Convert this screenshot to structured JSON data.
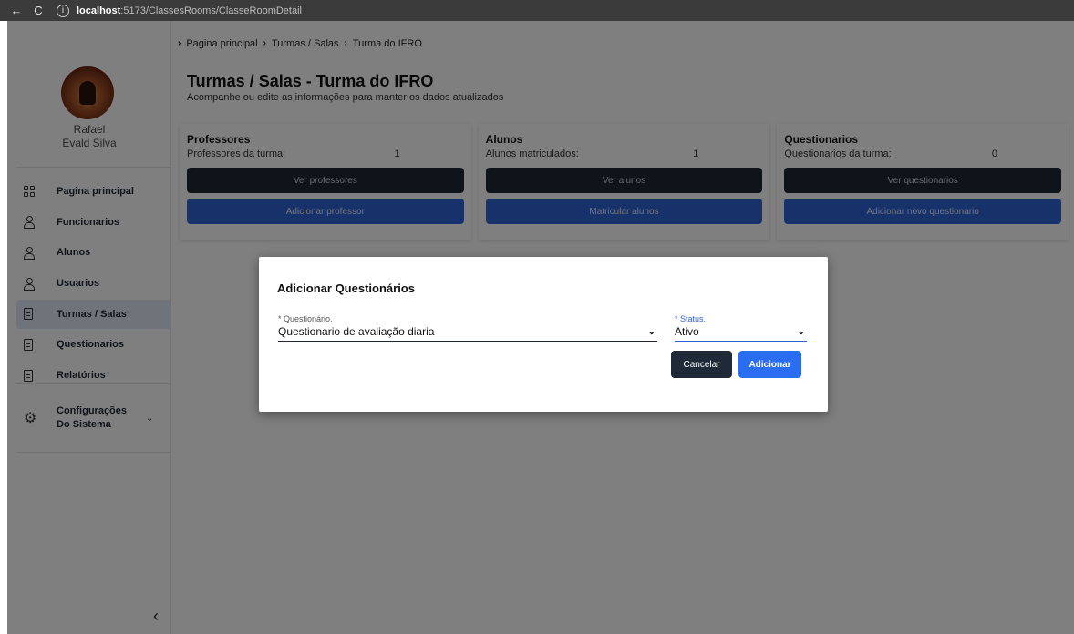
{
  "browser": {
    "back_icon": "←",
    "reload_icon": "C",
    "url_host": "localhost",
    "url_path": ":5173/ClassesRooms/ClasseRoomDetail"
  },
  "sidebar": {
    "user_first": "Rafael",
    "user_last": "Evald Silva",
    "items": [
      {
        "label": "Pagina principal",
        "icon": "grid-icon"
      },
      {
        "label": "Funcionarios",
        "icon": "person-icon"
      },
      {
        "label": "Alunos",
        "icon": "person-icon"
      },
      {
        "label": "Usuarios",
        "icon": "person-icon"
      },
      {
        "label": "Turmas / Salas",
        "icon": "document-icon",
        "active": true
      },
      {
        "label": "Questionarios",
        "icon": "document-icon"
      },
      {
        "label": "Relatórios",
        "icon": "document-icon"
      }
    ],
    "config_label": "Configurações Do Sistema",
    "collapse_glyph": "‹"
  },
  "breadcrumb": [
    "Pagina principal",
    "Turmas / Salas",
    "Turma do IFRO"
  ],
  "header": {
    "title": "Turmas / Salas - Turma do IFRO",
    "subtitle": "Acompanhe ou edite as informações para manter os dados atualizados"
  },
  "cards": [
    {
      "title": "Professores",
      "row_label": "Professores da turma:",
      "count": "1",
      "view_label": "Ver professores",
      "add_label": "Adicionar professor"
    },
    {
      "title": "Alunos",
      "row_label": "Alunos matriculados:",
      "count": "1",
      "view_label": "Ver alunos",
      "add_label": "Matricular alunos"
    },
    {
      "title": "Questionarios",
      "row_label": "Questionarios da turma:",
      "count": "0",
      "view_label": "Ver questionarios",
      "add_label": "Adicionar novo questionario"
    }
  ],
  "modal": {
    "title": "Adicionar Questionários",
    "questionario_label": "* Questionário.",
    "questionario_value": "Questionario de avaliação diaria",
    "status_label": "* Status.",
    "status_value": "Ativo",
    "cancel_label": "Cancelar",
    "add_label": "Adicionar"
  },
  "colors": {
    "dark_button": "#1f2937",
    "primary_blue": "#2f62d6",
    "active_menu_bg": "#dfe8f4",
    "overlay": "rgba(0,0,0,0.5)"
  }
}
